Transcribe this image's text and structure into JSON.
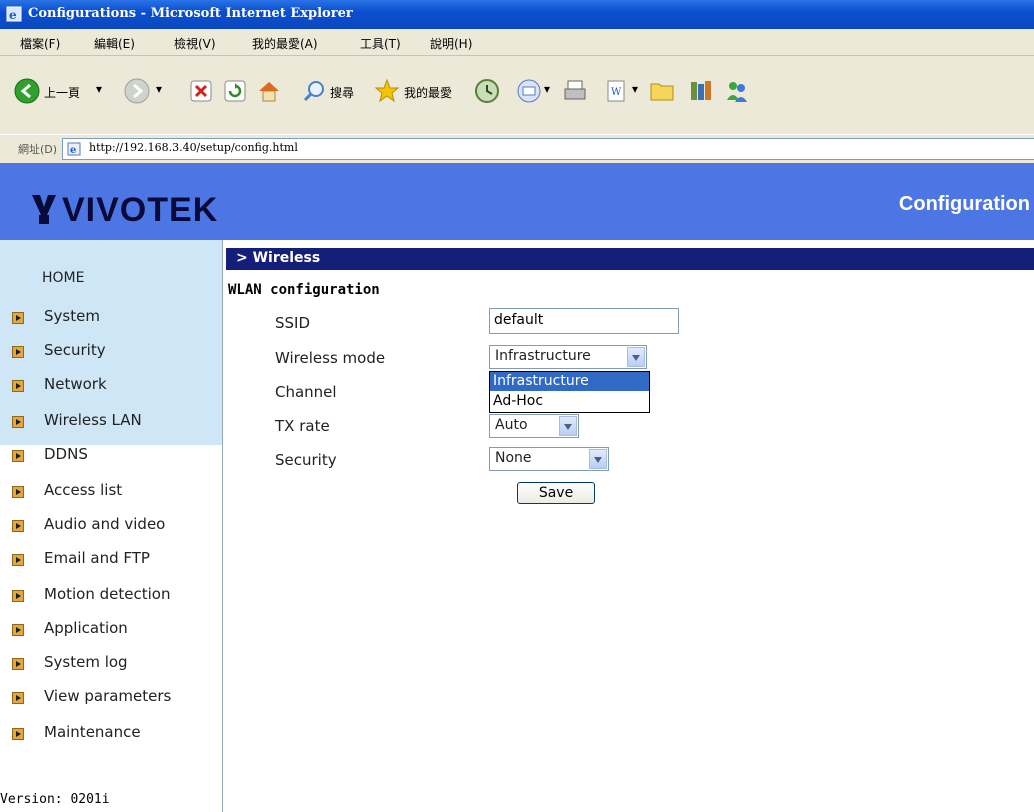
{
  "window": {
    "title": "Configurations - Microsoft Internet Explorer"
  },
  "menu": [
    "檔案(F)",
    "編輯(E)",
    "檢視(V)",
    "我的最愛(A)",
    "工具(T)",
    "說明(H)"
  ],
  "toolbar": {
    "back_label": "上一頁",
    "search_label": "搜尋",
    "favorites_label": "我的最愛"
  },
  "address": {
    "label": "網址(D)",
    "url": "http://192.168.3.40/setup/config.html"
  },
  "header": {
    "logo": "VIVOTEK",
    "title": "Configuration"
  },
  "sidebar": {
    "home": "HOME",
    "items": [
      "System",
      "Security",
      "Network",
      "Wireless LAN",
      "DDNS",
      "Access list",
      "Audio and video",
      "Email and FTP",
      "Motion detection",
      "Application",
      "System log",
      "View parameters",
      "Maintenance"
    ],
    "version": "Version: 0201i"
  },
  "main": {
    "section": "> Wireless",
    "subhead": "WLAN configuration",
    "labels": {
      "ssid": "SSID",
      "mode": "Wireless mode",
      "channel": "Channel",
      "txrate": "TX rate",
      "security": "Security"
    },
    "ssid_value": "default",
    "mode_value": "Infrastructure",
    "mode_options": [
      "Infrastructure",
      "Ad-Hoc"
    ],
    "txrate_value": "Auto",
    "security_value": "None",
    "save_label": "Save"
  },
  "colors": {
    "header_bg": "#4c76e3",
    "section_bg": "#141f7a",
    "sidebar_band": "#cfe6f7",
    "selection": "#316ac5"
  }
}
